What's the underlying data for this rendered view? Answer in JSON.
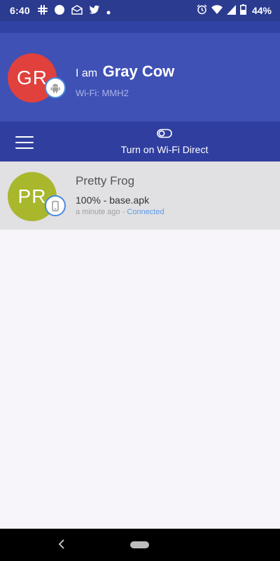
{
  "status_bar": {
    "time": "6:40",
    "battery_percent": "44%",
    "left_icons": [
      "slack-icon",
      "circle-icon",
      "mail-icon",
      "twitter-icon",
      "dot-icon"
    ],
    "right_icons": [
      "alarm-icon",
      "wifi-icon",
      "signal-icon",
      "battery-icon"
    ]
  },
  "profile": {
    "avatar_initials": "GR",
    "avatar_color": "#e0413c",
    "iam_prefix": "I am",
    "device_name": "Gray Cow",
    "wifi_label": "Wi-Fi: MMH2",
    "badge_icon": "android-icon"
  },
  "toolbar": {
    "menu_icon": "hamburger-menu-icon",
    "wifi_direct_icon": "toggle-icon",
    "wifi_direct_label": "Turn on Wi-Fi Direct"
  },
  "peers": [
    {
      "initials": "PR",
      "avatar_color": "#a8b72c",
      "name": "Pretty Frog",
      "progress": "100% - base.apk",
      "time": "a minute ago",
      "separator": " - ",
      "status": "Connected",
      "badge_icon": "phone-icon"
    }
  ],
  "colors": {
    "primary": "#3f51b5",
    "primary_dark": "#303f9f",
    "status_bar": "#2b3b8f",
    "connected": "#5d9be3"
  }
}
